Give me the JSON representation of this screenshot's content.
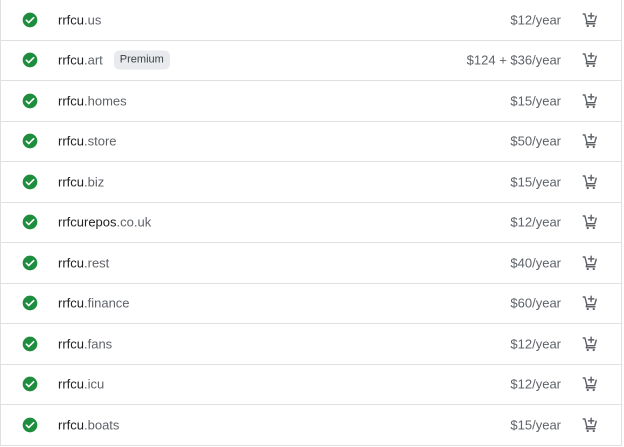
{
  "colors": {
    "check": "#1e8e3e",
    "border": "#e0e0e0",
    "text_primary": "#202124",
    "text_secondary": "#5f6368",
    "badge_bg": "#e8eaed"
  },
  "icons": {
    "status": "check-circle-icon",
    "action": "add-to-cart-icon"
  },
  "rows": [
    {
      "name": "rrfcu",
      "tld": ".us",
      "badge": "",
      "price": "$12/year"
    },
    {
      "name": "rrfcu",
      "tld": ".art",
      "badge": "Premium",
      "price": "$124 + $36/year"
    },
    {
      "name": "rrfcu",
      "tld": ".homes",
      "badge": "",
      "price": "$15/year"
    },
    {
      "name": "rrfcu",
      "tld": ".store",
      "badge": "",
      "price": "$50/year"
    },
    {
      "name": "rrfcu",
      "tld": ".biz",
      "badge": "",
      "price": "$15/year"
    },
    {
      "name": "rrfcurepos",
      "tld": ".co.uk",
      "badge": "",
      "price": "$12/year"
    },
    {
      "name": "rrfcu",
      "tld": ".rest",
      "badge": "",
      "price": "$40/year"
    },
    {
      "name": "rrfcu",
      "tld": ".finance",
      "badge": "",
      "price": "$60/year"
    },
    {
      "name": "rrfcu",
      "tld": ".fans",
      "badge": "",
      "price": "$12/year"
    },
    {
      "name": "rrfcu",
      "tld": ".icu",
      "badge": "",
      "price": "$12/year"
    },
    {
      "name": "rrfcu",
      "tld": ".boats",
      "badge": "",
      "price": "$15/year"
    }
  ]
}
